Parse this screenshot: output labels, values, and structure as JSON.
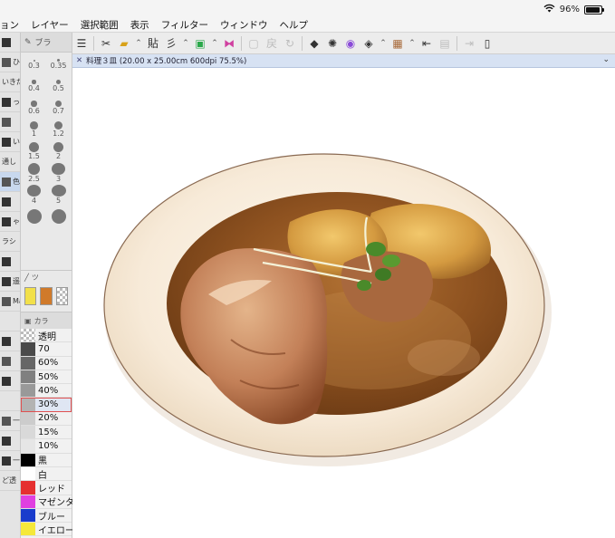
{
  "menu": {
    "items": [
      "ョン",
      "レイヤー",
      "選択範囲",
      "表示",
      "フィルター",
      "ウィンドウ",
      "ヘルプ"
    ]
  },
  "status": {
    "battery": "96%",
    "battery_level": 0.96
  },
  "toolbar": {
    "icons": [
      "menu-icon",
      "cut-icon",
      "open-folder-icon",
      "chevron-icon",
      "paste-icon",
      "transform-text-icon",
      "chevron-icon",
      "new-layer-icon",
      "chevron-icon",
      "flip-icon",
      "separator",
      "clear-icon",
      "undo-icon",
      "redo-icon",
      "separator",
      "fill-icon",
      "selection-icon",
      "stack-icon",
      "layers-icon",
      "chevron-icon",
      "color-grid-icon",
      "chevron-icon",
      "import-icon",
      "grid-icon",
      "separator",
      "export-icon",
      "settings-icon"
    ],
    "paste_label": "貼",
    "kanji_label": "戻"
  },
  "left_panel": {
    "items": [
      "",
      "ひ図",
      "いきだ",
      "っ入れ",
      "",
      "い形",
      "通し",
      "色取",
      "",
      "ゃ6",
      "ラシ",
      "",
      "遥",
      "Mail",
      "",
      "",
      "",
      "",
      "",
      "一蔵",
      "",
      "一形",
      "ど透"
    ]
  },
  "brush_panel": {
    "header": "ブラ",
    "sizes": [
      "0.3",
      "0.35",
      "0.4",
      "0.5",
      "0.6",
      "0.7",
      "1",
      "1.2",
      "1.5",
      "2",
      "2.5",
      "3",
      "4",
      "5",
      "",
      ""
    ]
  },
  "color_panel": {
    "header": "ツ",
    "main": "#f2e04a",
    "sub": "#d07a2a"
  },
  "color_set": {
    "header": "カラ",
    "items": [
      {
        "label": "透明",
        "color": "checker"
      },
      {
        "label": "70",
        "color": "#4a4a4a"
      },
      {
        "label": "60%",
        "color": "#666666"
      },
      {
        "label": "50%",
        "color": "#808080"
      },
      {
        "label": "40%",
        "color": "#999999"
      },
      {
        "label": "30%",
        "color": "#b3b3b3",
        "selected": true
      },
      {
        "label": "20%",
        "color": "#cccccc"
      },
      {
        "label": "15%",
        "color": "#d9d9d9"
      },
      {
        "label": "10%",
        "color": "#e6e6e6"
      },
      {
        "label": "黒",
        "color": "#000000"
      },
      {
        "label": "白",
        "color": "#ffffff"
      },
      {
        "label": "レッド",
        "color": "#e53030"
      },
      {
        "label": "マゼンタ",
        "color": "#e040e0"
      },
      {
        "label": "ブルー",
        "color": "#1a3ccc"
      },
      {
        "label": "イエロー",
        "color": "#f5e83a"
      }
    ]
  },
  "document": {
    "tab_title": "料理３皿 (20.00 x 25.00cm 600dpi 75.5%)"
  }
}
